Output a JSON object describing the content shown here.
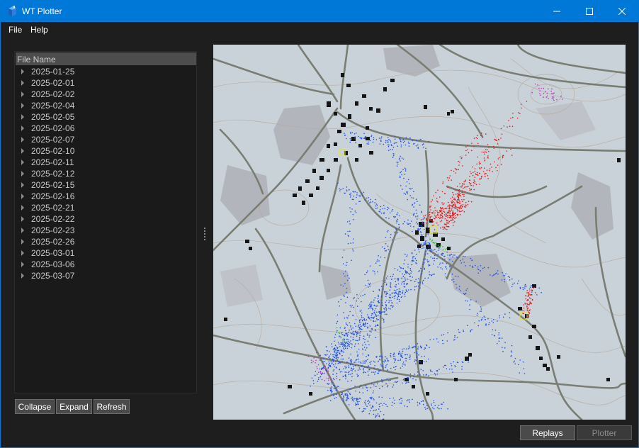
{
  "window": {
    "title": "WT Plotter",
    "minimize_icon": "minimize-icon",
    "maximize_icon": "maximize-icon",
    "close_icon": "close-icon"
  },
  "menu": {
    "file": "File",
    "help": "Help"
  },
  "tree": {
    "header": "File Name",
    "items": [
      {
        "label": "2025-01-25"
      },
      {
        "label": "2025-02-01"
      },
      {
        "label": "2025-02-02"
      },
      {
        "label": "2025-02-04"
      },
      {
        "label": "2025-02-05"
      },
      {
        "label": "2025-02-06"
      },
      {
        "label": "2025-02-07"
      },
      {
        "label": "2025-02-10"
      },
      {
        "label": "2025-02-11"
      },
      {
        "label": "2025-02-12"
      },
      {
        "label": "2025-02-15"
      },
      {
        "label": "2025-02-16"
      },
      {
        "label": "2025-02-21"
      },
      {
        "label": "2025-02-22"
      },
      {
        "label": "2025-02-23"
      },
      {
        "label": "2025-02-26"
      },
      {
        "label": "2025-03-01"
      },
      {
        "label": "2025-03-06"
      },
      {
        "label": "2025-03-07"
      }
    ]
  },
  "tree_buttons": {
    "collapse": "Collapse",
    "expand": "Expand",
    "refresh": "Refresh"
  },
  "bottom_buttons": {
    "replays": "Replays",
    "plotter": "Plotter"
  },
  "colors": {
    "titlebar": "#0078d7",
    "background": "#1e1e1e",
    "map_ground": "#c9d2d9",
    "track_blue": "#1e4fe6",
    "track_red": "#e01a1a",
    "track_magenta": "#d21ed2",
    "track_green": "#22c022",
    "track_yellow": "#e6e61e"
  }
}
